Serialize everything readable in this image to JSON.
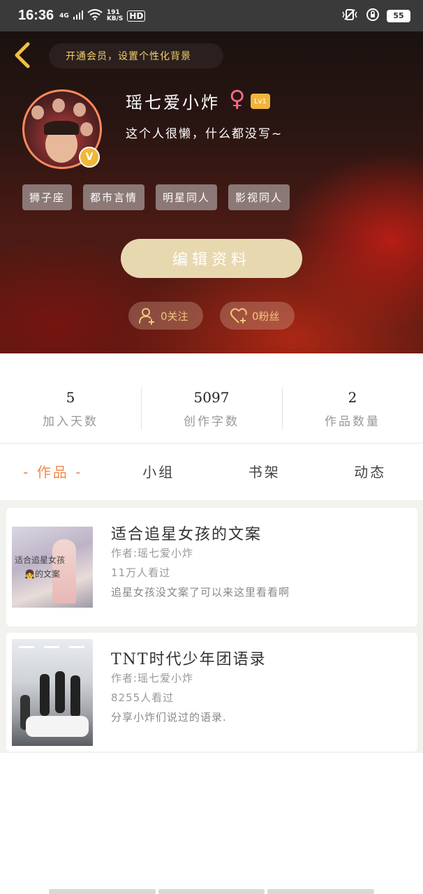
{
  "status_bar": {
    "time": "16:36",
    "network": "4G",
    "speed_value": "191",
    "speed_unit": "KB/S",
    "hd": "HD",
    "battery": "55"
  },
  "header": {
    "vip_banner": "开通会员，设置个性化背景",
    "username": "瑶七爱小炸",
    "gender_symbol": "♀",
    "level": "Lv1",
    "bio": "这个人很懒，什么都没写~",
    "verified_badge": "V",
    "tags": [
      "狮子座",
      "都市言情",
      "明星同人",
      "影视同人"
    ],
    "edit_button": "编辑资料",
    "follow_label": "0关注",
    "fans_label": "0粉丝"
  },
  "stats": [
    {
      "value": "5",
      "label": "加入天数"
    },
    {
      "value": "5097",
      "label": "创作字数"
    },
    {
      "value": "2",
      "label": "作品数量"
    }
  ],
  "tabs": [
    "- 作品 -",
    "小组",
    "书架",
    "动态"
  ],
  "works": [
    {
      "title": "适合追星女孩的文案",
      "author": "作者:瑶七爱小炸",
      "views": "11万人看过",
      "summary": "追星女孩没文案了可以来这里看看啊",
      "thumb_caption_1": "适合追星女孩",
      "thumb_caption_2": "👧的文案"
    },
    {
      "title": "TNT时代少年团语录",
      "author": "作者:瑶七爱小炸",
      "views": "8255人看过",
      "summary": "分享小炸们说过的语录."
    }
  ],
  "colors": {
    "accent": "#f08a50",
    "gold": "#f0c040",
    "edit_button_bg": "#e8d8b0"
  }
}
